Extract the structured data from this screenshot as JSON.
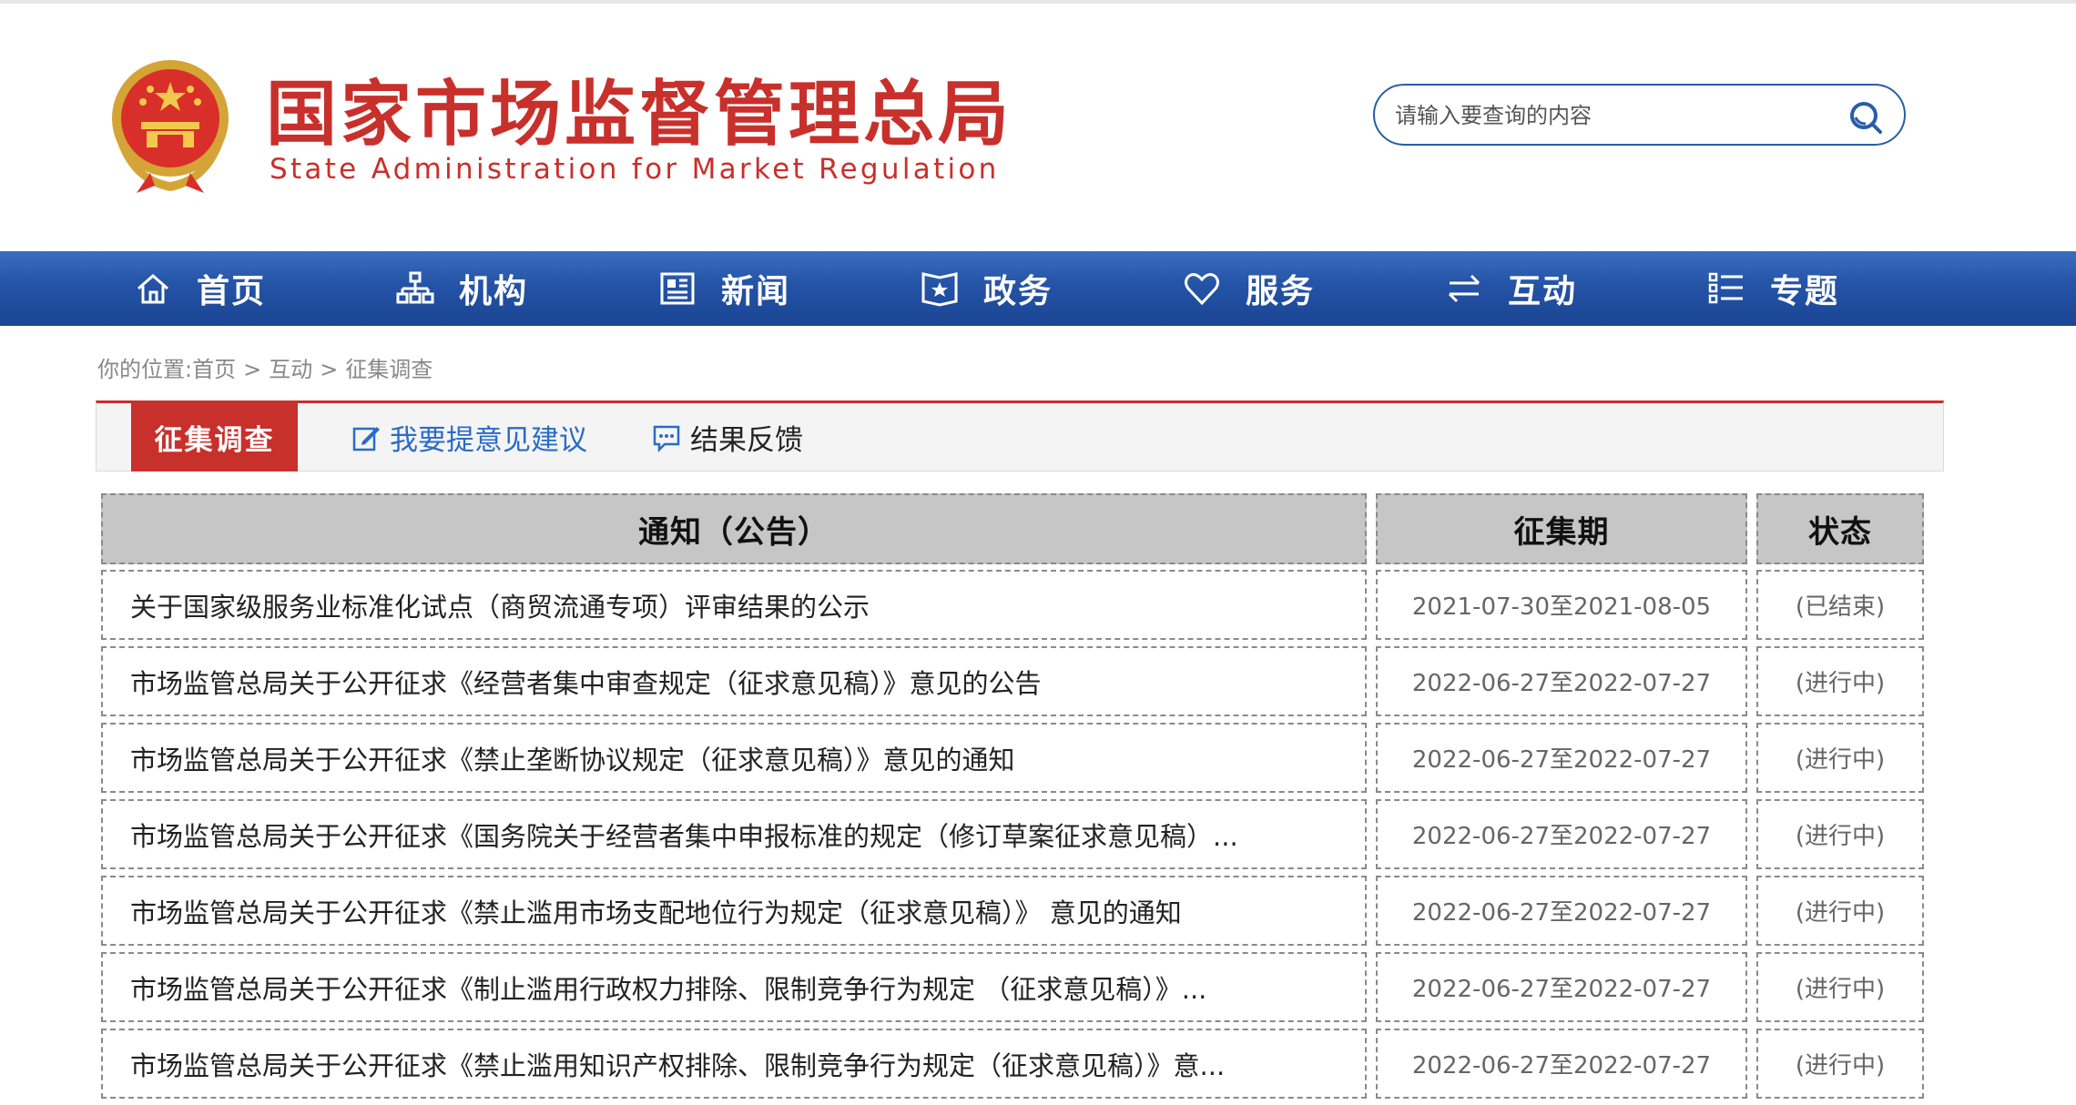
{
  "header": {
    "title": "国家市场监督管理总局",
    "subtitle": "State Administration for Market Regulation",
    "search_placeholder": "请输入要查询的内容"
  },
  "nav": {
    "items": [
      {
        "label": "首页",
        "icon": "home-icon"
      },
      {
        "label": "机构",
        "icon": "org-chart-icon"
      },
      {
        "label": "新闻",
        "icon": "newspaper-icon"
      },
      {
        "label": "政务",
        "icon": "document-star-icon"
      },
      {
        "label": "服务",
        "icon": "heart-icon"
      },
      {
        "label": "互动",
        "icon": "exchange-arrows-icon"
      },
      {
        "label": "专题",
        "icon": "topic-list-icon"
      }
    ]
  },
  "breadcrumb": {
    "prefix": "你的位置:",
    "items": [
      "首页",
      "互动",
      "征集调查"
    ],
    "separator": ">"
  },
  "tabs": {
    "active": "征集调查",
    "suggest": "我要提意见建议",
    "feedback": "结果反馈"
  },
  "table": {
    "headers": {
      "title": "通知（公告）",
      "period": "征集期",
      "status": "状态"
    },
    "rows": [
      {
        "title": "关于国家级服务业标准化试点（商贸流通专项）评审结果的公示",
        "period": "2021-07-30至2021-08-05",
        "status": "(已结束)"
      },
      {
        "title": "市场监管总局关于公开征求《经营者集中审查规定（征求意见稿）》意见的公告",
        "period": "2022-06-27至2022-07-27",
        "status": "(进行中)"
      },
      {
        "title": "市场监管总局关于公开征求《禁止垄断协议规定（征求意见稿）》意见的通知",
        "period": "2022-06-27至2022-07-27",
        "status": "(进行中)"
      },
      {
        "title": "市场监管总局关于公开征求《国务院关于经营者集中申报标准的规定（修订草案征求意见稿）...",
        "period": "2022-06-27至2022-07-27",
        "status": "(进行中)"
      },
      {
        "title": "市场监管总局关于公开征求《禁止滥用市场支配地位行为规定（征求意见稿）》 意见的通知",
        "period": "2022-06-27至2022-07-27",
        "status": "(进行中)"
      },
      {
        "title": "市场监管总局关于公开征求《制止滥用行政权力排除、限制竞争行为规定 （征求意见稿）》...",
        "period": "2022-06-27至2022-07-27",
        "status": "(进行中)"
      },
      {
        "title": "市场监管总局关于公开征求《禁止滥用知识产权排除、限制竞争行为规定（征求意见稿）》意...",
        "period": "2022-06-27至2022-07-27",
        "status": "(进行中)"
      }
    ]
  },
  "colors": {
    "brand_red": "#c8302b",
    "nav_blue": "#2453a6",
    "link_blue": "#2a6bc7",
    "header_gray": "#c6c6c6"
  }
}
